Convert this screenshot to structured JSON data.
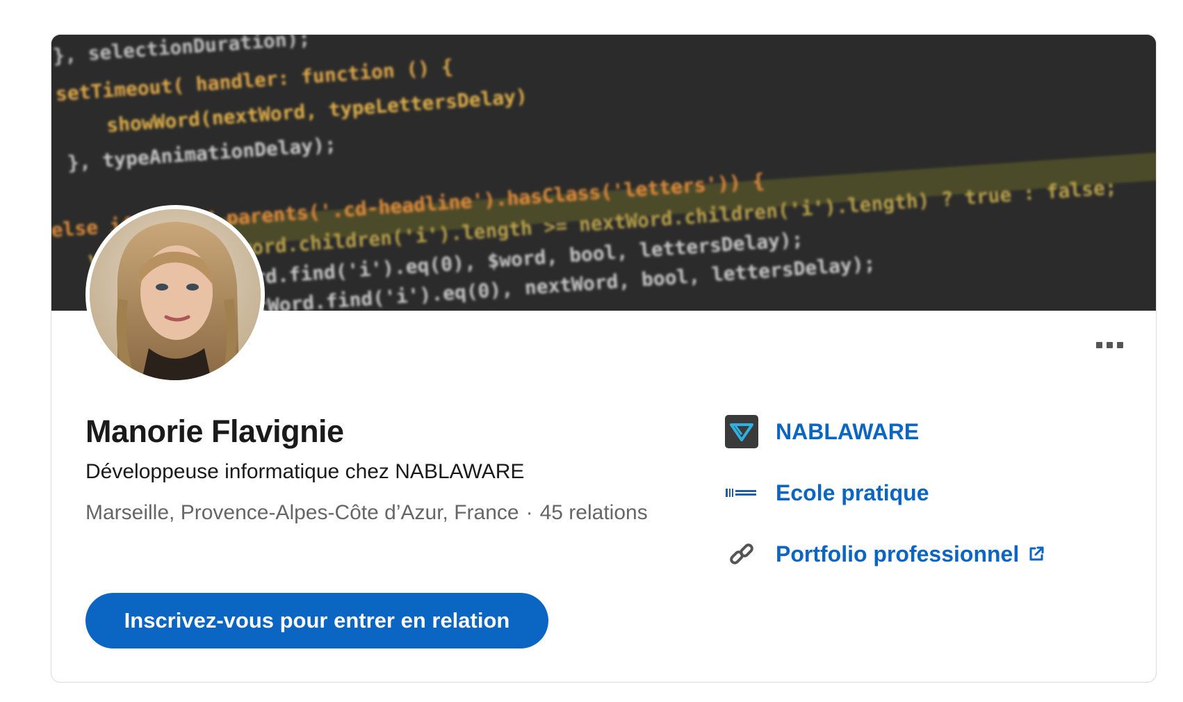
{
  "banner": {
    "code_lines": [
      "}, selectionDuration);",
      "setTimeout( handler: function () {",
      "showWord(nextWord, typeLettersDelay)",
      "}, typeAnimationDelay);",
      "else if ($word.parents('.cd-headline').hasClass('letters')) {",
      "var bool = ($word.children('i').length >= nextWord.children('i').length) ? true : false;",
      "hideLetter($word.find('i').eq(0), $word, bool, lettersDelay);",
      "showLetter(nextWord.find('i').eq(0), nextWord, bool, lettersDelay);"
    ]
  },
  "profile": {
    "name": "Manorie Flavignie",
    "headline": "Développeuse informatique chez NABLAWARE",
    "location": "Marseille, Provence-Alpes-Côte d’Azur, France",
    "separator": "·",
    "connections": "45 relations",
    "cta_label": "Inscrivez-vous pour entrer en relation"
  },
  "side_links": [
    {
      "label": "NABLAWARE",
      "icon": "nablaware-logo-icon"
    },
    {
      "label": "Ecole pratique",
      "icon": "ecole-pratique-logo-icon"
    },
    {
      "label": "Portfolio professionnel",
      "icon": "link-chain-icon"
    }
  ],
  "menu": {
    "icon": "more-options-icon"
  },
  "colors": {
    "accent": "#0a66c2",
    "banner_bg": "#2b2b2b",
    "text_primary": "#1a1a1a",
    "text_secondary": "#666666"
  }
}
